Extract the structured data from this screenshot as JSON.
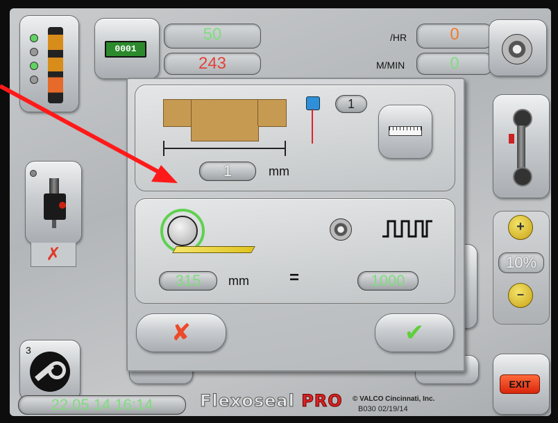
{
  "top": {
    "counter_icon": "counter-icon",
    "counter_display": "0001",
    "rate_value": "50",
    "rate_unit": "/HR",
    "rate_secondary": "0",
    "count_value": "243",
    "speed_unit": "M/MIN",
    "speed_value": "0"
  },
  "dialog": {
    "panel1": {
      "sensor_value": "1",
      "length_value": "1",
      "length_unit": "mm"
    },
    "panel2": {
      "circumference_value": "315",
      "circumference_unit": "mm",
      "equals": "=",
      "pulses_value": "1000"
    },
    "cancel_icon": "red-x-icon",
    "ok_icon": "checkmark-icon"
  },
  "right": {
    "speed_percent": "10%",
    "exit_label": "EXIT"
  },
  "left": {
    "tool_number": "3"
  },
  "footer": {
    "datetime": "22.05.14 16:14",
    "brand_a": "Flexoseal",
    "brand_b": "PRO",
    "company": "© VALCO Cincinnati, Inc.",
    "version": "B030 02/19/14"
  },
  "colors": {
    "green_text": "#7fdc7f",
    "red_text": "#e0443a",
    "annotation_arrow": "#ff1a1a"
  }
}
